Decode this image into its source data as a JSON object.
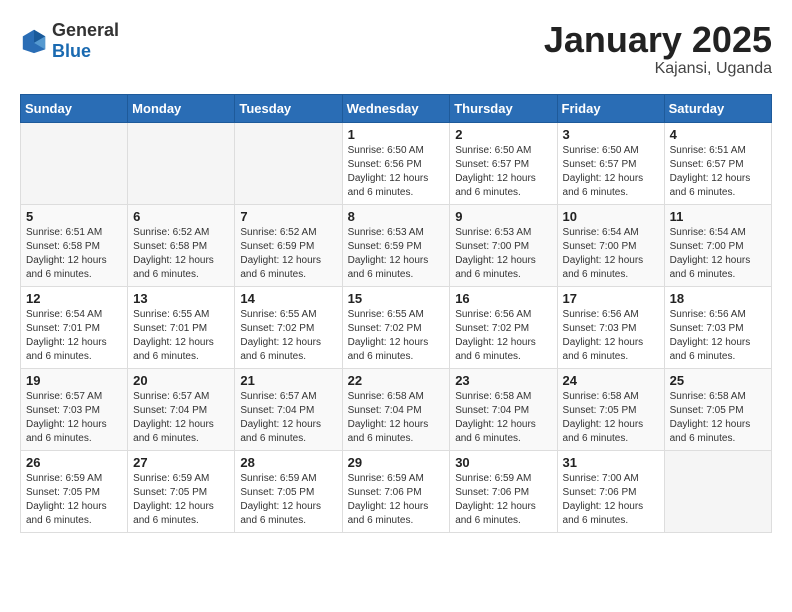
{
  "header": {
    "logo_general": "General",
    "logo_blue": "Blue",
    "month": "January 2025",
    "location": "Kajansi, Uganda"
  },
  "weekdays": [
    "Sunday",
    "Monday",
    "Tuesday",
    "Wednesday",
    "Thursday",
    "Friday",
    "Saturday"
  ],
  "weeks": [
    [
      {
        "day": "",
        "info": ""
      },
      {
        "day": "",
        "info": ""
      },
      {
        "day": "",
        "info": ""
      },
      {
        "day": "1",
        "info": "Sunrise: 6:50 AM\nSunset: 6:56 PM\nDaylight: 12 hours\nand 6 minutes."
      },
      {
        "day": "2",
        "info": "Sunrise: 6:50 AM\nSunset: 6:57 PM\nDaylight: 12 hours\nand 6 minutes."
      },
      {
        "day": "3",
        "info": "Sunrise: 6:50 AM\nSunset: 6:57 PM\nDaylight: 12 hours\nand 6 minutes."
      },
      {
        "day": "4",
        "info": "Sunrise: 6:51 AM\nSunset: 6:57 PM\nDaylight: 12 hours\nand 6 minutes."
      }
    ],
    [
      {
        "day": "5",
        "info": "Sunrise: 6:51 AM\nSunset: 6:58 PM\nDaylight: 12 hours\nand 6 minutes."
      },
      {
        "day": "6",
        "info": "Sunrise: 6:52 AM\nSunset: 6:58 PM\nDaylight: 12 hours\nand 6 minutes."
      },
      {
        "day": "7",
        "info": "Sunrise: 6:52 AM\nSunset: 6:59 PM\nDaylight: 12 hours\nand 6 minutes."
      },
      {
        "day": "8",
        "info": "Sunrise: 6:53 AM\nSunset: 6:59 PM\nDaylight: 12 hours\nand 6 minutes."
      },
      {
        "day": "9",
        "info": "Sunrise: 6:53 AM\nSunset: 7:00 PM\nDaylight: 12 hours\nand 6 minutes."
      },
      {
        "day": "10",
        "info": "Sunrise: 6:54 AM\nSunset: 7:00 PM\nDaylight: 12 hours\nand 6 minutes."
      },
      {
        "day": "11",
        "info": "Sunrise: 6:54 AM\nSunset: 7:00 PM\nDaylight: 12 hours\nand 6 minutes."
      }
    ],
    [
      {
        "day": "12",
        "info": "Sunrise: 6:54 AM\nSunset: 7:01 PM\nDaylight: 12 hours\nand 6 minutes."
      },
      {
        "day": "13",
        "info": "Sunrise: 6:55 AM\nSunset: 7:01 PM\nDaylight: 12 hours\nand 6 minutes."
      },
      {
        "day": "14",
        "info": "Sunrise: 6:55 AM\nSunset: 7:02 PM\nDaylight: 12 hours\nand 6 minutes."
      },
      {
        "day": "15",
        "info": "Sunrise: 6:55 AM\nSunset: 7:02 PM\nDaylight: 12 hours\nand 6 minutes."
      },
      {
        "day": "16",
        "info": "Sunrise: 6:56 AM\nSunset: 7:02 PM\nDaylight: 12 hours\nand 6 minutes."
      },
      {
        "day": "17",
        "info": "Sunrise: 6:56 AM\nSunset: 7:03 PM\nDaylight: 12 hours\nand 6 minutes."
      },
      {
        "day": "18",
        "info": "Sunrise: 6:56 AM\nSunset: 7:03 PM\nDaylight: 12 hours\nand 6 minutes."
      }
    ],
    [
      {
        "day": "19",
        "info": "Sunrise: 6:57 AM\nSunset: 7:03 PM\nDaylight: 12 hours\nand 6 minutes."
      },
      {
        "day": "20",
        "info": "Sunrise: 6:57 AM\nSunset: 7:04 PM\nDaylight: 12 hours\nand 6 minutes."
      },
      {
        "day": "21",
        "info": "Sunrise: 6:57 AM\nSunset: 7:04 PM\nDaylight: 12 hours\nand 6 minutes."
      },
      {
        "day": "22",
        "info": "Sunrise: 6:58 AM\nSunset: 7:04 PM\nDaylight: 12 hours\nand 6 minutes."
      },
      {
        "day": "23",
        "info": "Sunrise: 6:58 AM\nSunset: 7:04 PM\nDaylight: 12 hours\nand 6 minutes."
      },
      {
        "day": "24",
        "info": "Sunrise: 6:58 AM\nSunset: 7:05 PM\nDaylight: 12 hours\nand 6 minutes."
      },
      {
        "day": "25",
        "info": "Sunrise: 6:58 AM\nSunset: 7:05 PM\nDaylight: 12 hours\nand 6 minutes."
      }
    ],
    [
      {
        "day": "26",
        "info": "Sunrise: 6:59 AM\nSunset: 7:05 PM\nDaylight: 12 hours\nand 6 minutes."
      },
      {
        "day": "27",
        "info": "Sunrise: 6:59 AM\nSunset: 7:05 PM\nDaylight: 12 hours\nand 6 minutes."
      },
      {
        "day": "28",
        "info": "Sunrise: 6:59 AM\nSunset: 7:05 PM\nDaylight: 12 hours\nand 6 minutes."
      },
      {
        "day": "29",
        "info": "Sunrise: 6:59 AM\nSunset: 7:06 PM\nDaylight: 12 hours\nand 6 minutes."
      },
      {
        "day": "30",
        "info": "Sunrise: 6:59 AM\nSunset: 7:06 PM\nDaylight: 12 hours\nand 6 minutes."
      },
      {
        "day": "31",
        "info": "Sunrise: 7:00 AM\nSunset: 7:06 PM\nDaylight: 12 hours\nand 6 minutes."
      },
      {
        "day": "",
        "info": ""
      }
    ]
  ]
}
